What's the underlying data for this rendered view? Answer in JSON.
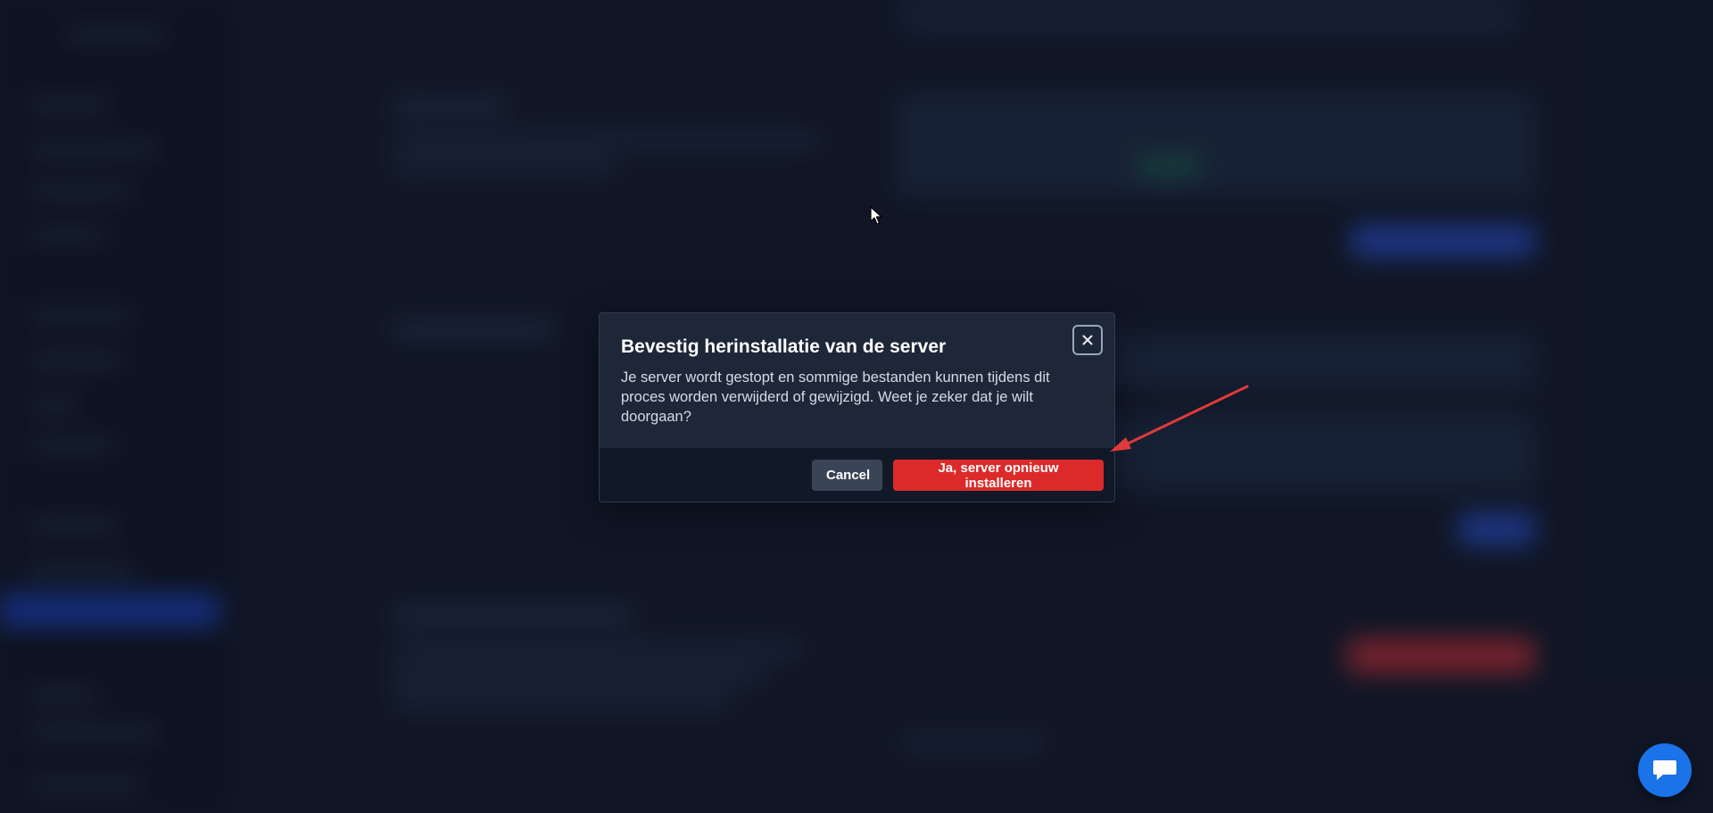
{
  "modal": {
    "title": "Bevestig herinstallatie van de server",
    "message": "Je server wordt gestopt en sommige bestanden kunnen tijdens dit proces worden verwijderd of gewijzigd. Weet je zeker dat je wilt doorgaan?",
    "close_icon": "close-icon",
    "cancel_label": "Cancel",
    "confirm_label": "Ja, server opnieuw installeren"
  },
  "colors": {
    "confirm": "#dc2a2a",
    "cancel": "#3a4457",
    "annotation_arrow": "#e03a3a",
    "chat": "#1a73e8"
  },
  "chat": {
    "icon": "chat-bubble-icon"
  }
}
